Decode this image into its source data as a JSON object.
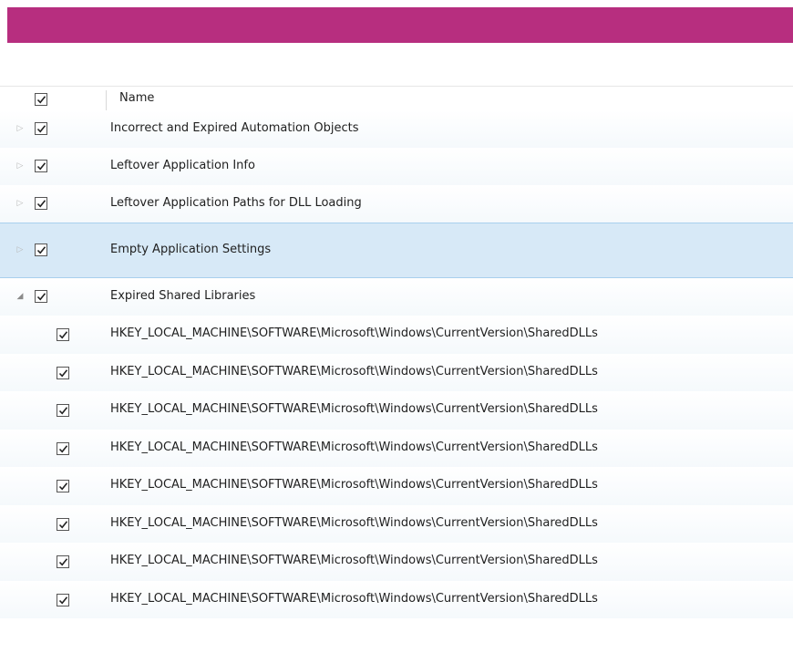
{
  "header": {
    "name_label": "Name"
  },
  "items": [
    {
      "label": "Incorrect and Expired Automation Objects"
    },
    {
      "label": "Leftover Application Info"
    },
    {
      "label": "Leftover Application Paths for DLL Loading"
    },
    {
      "label": "Empty Application Settings"
    },
    {
      "label": "Expired Shared Libraries"
    }
  ],
  "children": [
    {
      "label": "HKEY_LOCAL_MACHINE\\SOFTWARE\\Microsoft\\Windows\\CurrentVersion\\SharedDLLs"
    },
    {
      "label": "HKEY_LOCAL_MACHINE\\SOFTWARE\\Microsoft\\Windows\\CurrentVersion\\SharedDLLs"
    },
    {
      "label": "HKEY_LOCAL_MACHINE\\SOFTWARE\\Microsoft\\Windows\\CurrentVersion\\SharedDLLs"
    },
    {
      "label": "HKEY_LOCAL_MACHINE\\SOFTWARE\\Microsoft\\Windows\\CurrentVersion\\SharedDLLs"
    },
    {
      "label": "HKEY_LOCAL_MACHINE\\SOFTWARE\\Microsoft\\Windows\\CurrentVersion\\SharedDLLs"
    },
    {
      "label": "HKEY_LOCAL_MACHINE\\SOFTWARE\\Microsoft\\Windows\\CurrentVersion\\SharedDLLs"
    },
    {
      "label": "HKEY_LOCAL_MACHINE\\SOFTWARE\\Microsoft\\Windows\\CurrentVersion\\SharedDLLs"
    },
    {
      "label": "HKEY_LOCAL_MACHINE\\SOFTWARE\\Microsoft\\Windows\\CurrentVersion\\SharedDLLs"
    }
  ],
  "colors": {
    "accent": "#b72e7f",
    "selected_row": "#d7e9f7"
  },
  "icons": {
    "collapsed": "triangle-right-icon",
    "expanded": "triangle-down-icon",
    "check": "checkmark-icon"
  }
}
